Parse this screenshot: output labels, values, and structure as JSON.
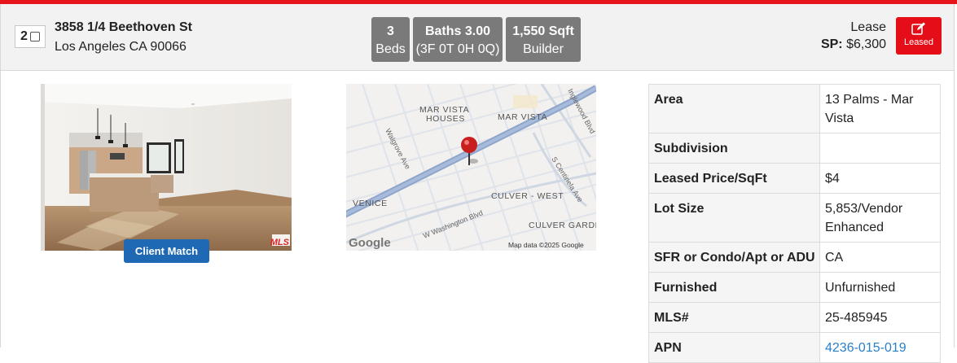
{
  "listing": {
    "index": "2",
    "address_line1": "3858 1/4 Beethoven St",
    "address_line2": "Los Angeles CA 90066",
    "stats": [
      {
        "top": "3",
        "bottom": "Beds"
      },
      {
        "top": "Baths 3.00",
        "bottom": "(3F 0T 0H 0Q)"
      },
      {
        "top": "1,550 Sqft",
        "bottom": "Builder"
      }
    ],
    "status_label": "Lease",
    "price_label": "SP:",
    "price_value": "$6,300",
    "leased_button_label": "Leased",
    "accent_color": "#e8141b"
  },
  "photo": {
    "client_match_label": "Client Match",
    "watermark": "MLS"
  },
  "map": {
    "labels": {
      "mar_vista_houses_1": "MAR VISTA",
      "mar_vista_houses_2": "HOUSES",
      "mar_vista": "MAR VISTA",
      "walgrove": "Walgrove Ave",
      "inglewood": "Inglewood Blvd",
      "centinela": "S Centinela Ave",
      "venice": "VENICE",
      "culver_west": "CULVER - WEST",
      "washington": "W Washington Blvd",
      "culver_gardens": "CULVER GARDE",
      "google": "Google",
      "attribution": "Map data ©2025 Google"
    }
  },
  "details": [
    {
      "label": "Area",
      "value": "13 Palms - Mar Vista",
      "link": false
    },
    {
      "label": "Subdivision",
      "value": "",
      "link": false
    },
    {
      "label": "Leased Price/SqFt",
      "value": "$4",
      "link": false
    },
    {
      "label": "Lot Size",
      "value": "5,853/Vendor Enhanced",
      "link": false
    },
    {
      "label": "SFR or Condo/Apt or ADU",
      "value": "CA",
      "link": false
    },
    {
      "label": "Furnished",
      "value": "Unfurnished",
      "link": false
    },
    {
      "label": "MLS#",
      "value": "25-485945",
      "link": false
    },
    {
      "label": "APN",
      "value": "4236-015-019",
      "link": true
    }
  ]
}
